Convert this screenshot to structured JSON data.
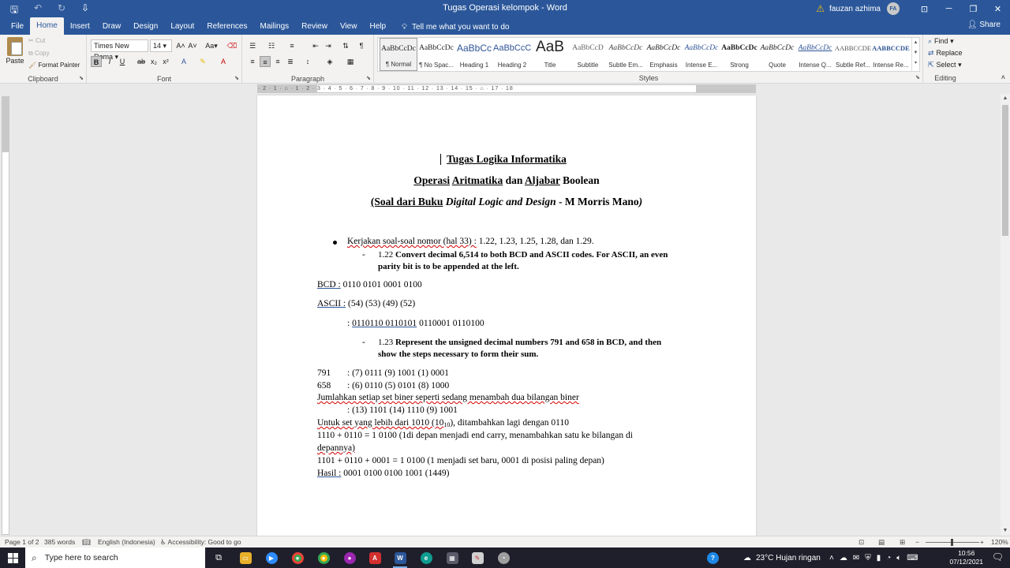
{
  "window": {
    "title": "Tugas Operasi kelompok  -  Word",
    "user_name": "fauzan azhima",
    "user_initials": "FA",
    "qat_icons": [
      "save-icon",
      "undo-icon",
      "redo-icon",
      "customize-icon"
    ]
  },
  "menu": {
    "tabs": [
      "File",
      "Home",
      "Insert",
      "Draw",
      "Design",
      "Layout",
      "References",
      "Mailings",
      "Review",
      "View",
      "Help"
    ],
    "active": "Home",
    "tell_me": "Tell me what you want to do",
    "share": "Share"
  },
  "ribbon": {
    "clipboard": {
      "paste": "Paste",
      "cut": "Cut",
      "copy": "Copy",
      "format_painter": "Format Painter",
      "label": "Clipboard"
    },
    "font": {
      "name": "Times New Roma",
      "size": "14",
      "case": "Aa",
      "label": "Font"
    },
    "paragraph": {
      "label": "Paragraph"
    },
    "styles": {
      "label": "Styles",
      "items": [
        {
          "preview": "AaBbCcDc",
          "name": "¶ Normal"
        },
        {
          "preview": "AaBbCcDc",
          "name": "¶ No Spac..."
        },
        {
          "preview": "AaBbCc",
          "name": "Heading 1"
        },
        {
          "preview": "AaBbCcC",
          "name": "Heading 2"
        },
        {
          "preview": "AaB",
          "name": "Title"
        },
        {
          "preview": "AaBbCcD",
          "name": "Subtitle"
        },
        {
          "preview": "AaBbCcDc",
          "name": "Subtle Em..."
        },
        {
          "preview": "AaBbCcDc",
          "name": "Emphasis"
        },
        {
          "preview": "AaBbCcDc",
          "name": "Intense E..."
        },
        {
          "preview": "AaBbCcDc",
          "name": "Strong"
        },
        {
          "preview": "AaBbCcDc",
          "name": "Quote"
        },
        {
          "preview": "AaBbCcDc",
          "name": "Intense Q..."
        },
        {
          "preview": "AABBCCDE",
          "name": "Subtle Ref..."
        },
        {
          "preview": "AABBCCDE",
          "name": "Intense Re..."
        }
      ]
    },
    "editing": {
      "find": "Find",
      "replace": "Replace",
      "select": "Select",
      "label": "Editing"
    }
  },
  "ruler": {
    "marks": "· 2 · 1 · ⌂ · 1 · 2 · 3 · 4 · 5 · 6 · 7 · 8 · 9 · 10 · 11 · 12 · 13 · 14 · 15 · ⌂ · 17 · 18"
  },
  "document": {
    "title1": "Tugas Logika Informatika",
    "title2_a": "Operasi",
    "title2_b": "Aritmatika",
    "title2_c": "dan",
    "title2_d": "Aljabar",
    "title2_e": "Boolean",
    "title3_a": "(Soal dari Buku",
    "title3_b": "Digital Logic and Design",
    "title3_c": "- M Morris Mano",
    "title3_d": ")",
    "bullet_a": "Kerjakan soal-soal nomor (hal 33) :",
    "bullet_b": " 1.22, 1.23, 1.25, 1.28, dan 1.29.",
    "q122_num": "1.22",
    "q122_dash": "-",
    "q122_line1": "Convert decimal 6,514 to both BCD and ASCII codes. For ASCII, an even",
    "q122_line2": "parity bit is to be appended at the left.",
    "bcd_label": "BCD :",
    "bcd_value": " 0110 0101 0001 0100",
    "ascii_label": "ASCII :",
    "ascii_value": " (54) (53) (49) (52)",
    "ascii_bin_colon": ":",
    "ascii_bin_a": "0110110  0110101",
    "ascii_bin_b": "  0110001  0110100",
    "q123_num": "1.23",
    "q123_dash": "-",
    "q123_line1": "Represent the unsigned decimal numbers 791 and 658 in BCD, and then",
    "q123_line2": "show the steps necessary to form their sum.",
    "n791": "791",
    "n791_val": ": (7) 0111 (9) 1001 (1) 0001",
    "n658": "658",
    "n658_val": ": (6) 0110 (5) 0101 (8) 1000",
    "jumlah": "Jumlahkan setiap set biner seperti sedang menambah dua bilangan biner",
    "jumlah_val": ": (13) 1101 (14) 1110 (9) 1001",
    "untuk_a": "Untuk set yang lebih dari 1010 (10",
    "untuk_sub": "10",
    "untuk_b": "), ditambahkan lagi dengan 0110",
    "line_1110_a": "1110 + 0110 = 1 0100 (1di depan menjadi end carry, menambahkan  satu ke bilangan di",
    "line_1110_b": "depannya)",
    "line_1101": "1101 + 0110 + 0001 = 1 0100 (1 menjadi set baru, 0001 di posisi paling depan)",
    "hasil_label": "Hasil :",
    "hasil_value": " 0001 0100 0100 1001 (1449)"
  },
  "status": {
    "page": "Page 1 of 2",
    "words": "385 words",
    "language": "English (Indonesia)",
    "accessibility": "Accessibility: Good to go",
    "zoom": "120%"
  },
  "taskbar": {
    "search_placeholder": "Type here to search",
    "weather": "23°C  Hujan ringan",
    "time": "10:56",
    "date": "07/12/2021"
  },
  "colors": {
    "word_blue": "#2b579a",
    "ribbon_bg": "#f3f2f1",
    "taskbar_bg": "#1f1f2b"
  }
}
